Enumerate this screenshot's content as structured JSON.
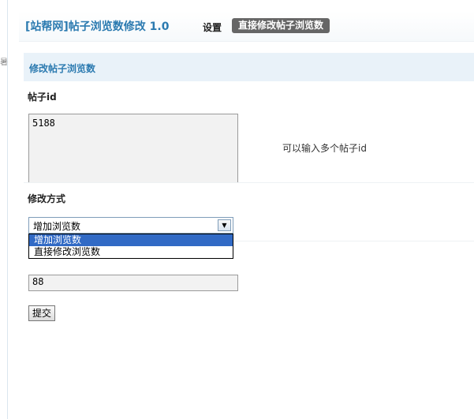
{
  "header": {
    "app_title": "[站帮网]帖子浏览数修改 1.0",
    "nav": {
      "settings": "设置",
      "active": "直接修改帖子浏览数"
    }
  },
  "section": {
    "title": "修改帖子浏览数"
  },
  "form": {
    "post_id_label": "帖子id",
    "post_id_value": "5188",
    "post_id_hint": "可以输入多个帖子id",
    "mode_label": "修改方式",
    "mode_selected": "增加浏览数",
    "mode_options": [
      "增加浏览数",
      "直接修改浏览数"
    ],
    "mode_highlighted_index": 0,
    "count_value": "88",
    "submit_label": "提交"
  }
}
